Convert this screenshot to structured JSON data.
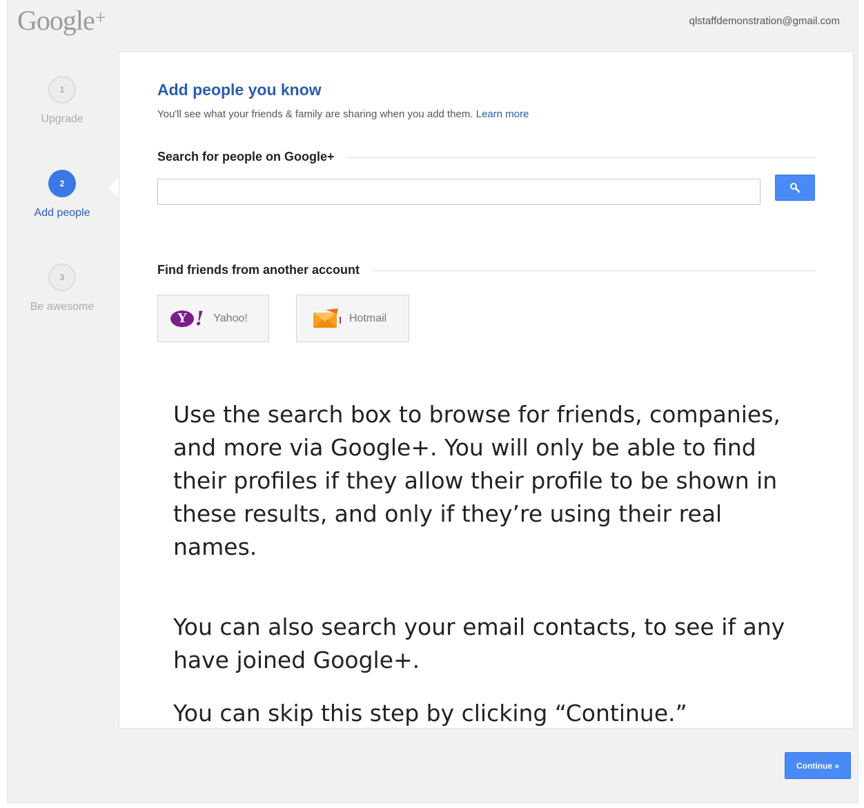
{
  "header": {
    "logo_text": "Google",
    "logo_plus": "+",
    "account_email": "qlstaffdemonstration@gmail.com"
  },
  "steps": [
    {
      "number": "1",
      "label": "Upgrade"
    },
    {
      "number": "2",
      "label": "Add people"
    },
    {
      "number": "3",
      "label": "Be awesome"
    }
  ],
  "active_step": 2,
  "main": {
    "title": "Add people you know",
    "subtitle": "You'll see what your friends & family are sharing when you add them.",
    "learn_more": "Learn more",
    "search_heading": "Search for people on Google+",
    "search_value": "",
    "search_icon": "search-icon",
    "find_heading": "Find friends from another account",
    "accounts": [
      {
        "label": "Yahoo!",
        "icon": "yahoo-logo"
      },
      {
        "label": "Hotmail",
        "icon": "hotmail-logo"
      }
    ]
  },
  "notes": {
    "paragraph1": "Use the search box to browse for friends, companies, and more via Google+. You will only be able to find their profiles if they allow their profile to be shown in these results, and only if they’re using their real names.",
    "paragraph2": "You can also search your email contacts, to see if any have joined Google+.",
    "paragraph3": "You can skip this step by clicking “Continue.”"
  },
  "footer": {
    "continue_label": "Continue »"
  },
  "colors": {
    "brand_blue": "#2a5db0",
    "button_blue": "#4a8af4",
    "accent_orange": "#f36c21"
  }
}
